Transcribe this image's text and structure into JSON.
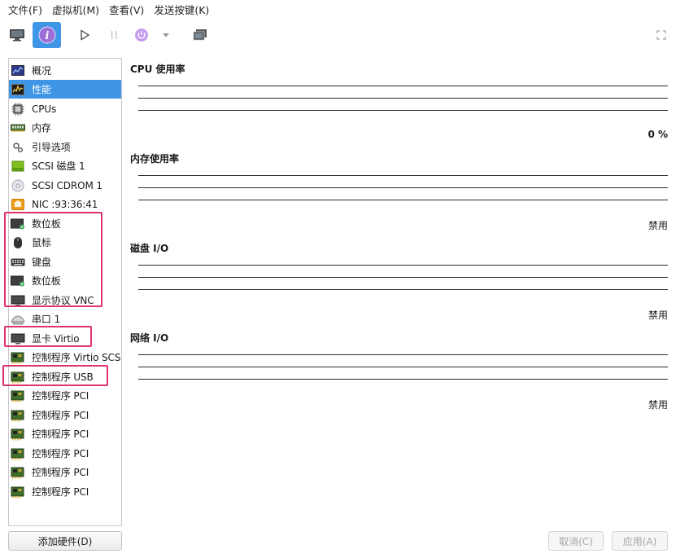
{
  "menubar": [
    "文件(F)",
    "虚拟机(M)",
    "查看(V)",
    "发送按键(K)"
  ],
  "colors": {
    "accent": "#3f96e6",
    "highlight": "#e0336a",
    "chip_green": "#7fbf1f",
    "nic_orange": "#f0a020",
    "cpu_purple": "#9a6fd6"
  },
  "toolbar": {
    "icons": [
      "monitor-icon",
      "info-icon",
      "play-icon",
      "pause-icon",
      "power-icon",
      "dropdown-arrow-icon",
      "screenshot-icon",
      "fullscreen-icon"
    ]
  },
  "sidebar": {
    "items": [
      {
        "label": "概况",
        "icon": "overview-icon"
      },
      {
        "label": "性能",
        "icon": "performance-icon",
        "selected": true
      },
      {
        "label": "CPUs",
        "icon": "cpu-icon"
      },
      {
        "label": "内存",
        "icon": "memory-icon"
      },
      {
        "label": "引导选项",
        "icon": "boot-options-icon"
      },
      {
        "label": "SCSI 磁盘 1",
        "icon": "disk-icon"
      },
      {
        "label": "SCSI CDROM 1",
        "icon": "cdrom-icon"
      },
      {
        "label": "NIC :93:36:41",
        "icon": "nic-icon"
      },
      {
        "label": "数位板",
        "icon": "tablet-icon"
      },
      {
        "label": "鼠标",
        "icon": "mouse-icon"
      },
      {
        "label": "键盘",
        "icon": "keyboard-icon"
      },
      {
        "label": "数位板",
        "icon": "tablet-icon"
      },
      {
        "label": "显示协议 VNC",
        "icon": "display-icon"
      },
      {
        "label": "串口 1",
        "icon": "serial-icon"
      },
      {
        "label": "显卡 Virtio",
        "icon": "video-card-icon"
      },
      {
        "label": "控制程序 Virtio SCSI",
        "icon": "controller-icon"
      },
      {
        "label": "控制程序 USB",
        "icon": "controller-icon"
      },
      {
        "label": "控制程序 PCI",
        "icon": "controller-icon"
      },
      {
        "label": "控制程序 PCI",
        "icon": "controller-icon"
      },
      {
        "label": "控制程序 PCI",
        "icon": "controller-icon"
      },
      {
        "label": "控制程序 PCI",
        "icon": "controller-icon"
      },
      {
        "label": "控制程序 PCI",
        "icon": "controller-icon"
      },
      {
        "label": "控制程序 PCI",
        "icon": "controller-icon"
      }
    ]
  },
  "performance": {
    "sections": [
      {
        "title": "CPU 使用率",
        "value": "0 %"
      },
      {
        "title": "内存使用率",
        "value": "禁用"
      },
      {
        "title": "磁盘 I/O",
        "value": "禁用"
      },
      {
        "title": "网络 I/O",
        "value": "禁用"
      }
    ]
  },
  "footer": {
    "add_hardware": "添加硬件(D)",
    "cancel": "取消(C)",
    "apply": "应用(A)"
  }
}
